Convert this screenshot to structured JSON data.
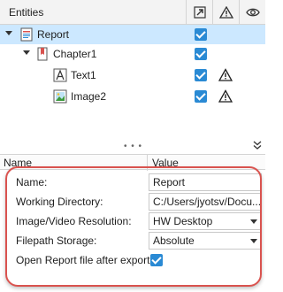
{
  "entities": {
    "header": {
      "title": "Entities"
    },
    "nodes": [
      {
        "label": "Report",
        "level": 0,
        "expanded": true,
        "selected": true,
        "icon": "report-icon",
        "checked": true,
        "warning": false
      },
      {
        "label": "Chapter1",
        "level": 1,
        "expanded": true,
        "selected": false,
        "icon": "chapter-icon",
        "checked": true,
        "warning": false
      },
      {
        "label": "Text1",
        "level": 2,
        "expanded": false,
        "selected": false,
        "icon": "text-icon",
        "checked": true,
        "warning": true
      },
      {
        "label": "Image2",
        "level": 2,
        "expanded": false,
        "selected": false,
        "icon": "image-icon",
        "checked": true,
        "warning": true
      }
    ]
  },
  "splitter": {
    "grip": "• • •"
  },
  "properties": {
    "header": {
      "name": "Name",
      "value": "Value"
    },
    "rows": [
      {
        "name": "Name:",
        "value": "Report",
        "kind": "text"
      },
      {
        "name": "Working Directory:",
        "value": "C:/Users/jyotsv/Docu...",
        "kind": "text"
      },
      {
        "name": "Image/Video Resolution:",
        "value": "HW Desktop",
        "kind": "select"
      },
      {
        "name": "Filepath Storage:",
        "value": "Absolute",
        "kind": "select"
      },
      {
        "name": "Open Report file after export:",
        "value": true,
        "kind": "checkbox"
      }
    ]
  },
  "colors": {
    "accent": "#2a8ad4",
    "selection": "#cce8ff",
    "highlight": "#d9534f",
    "warning": "#1e1e1e"
  }
}
